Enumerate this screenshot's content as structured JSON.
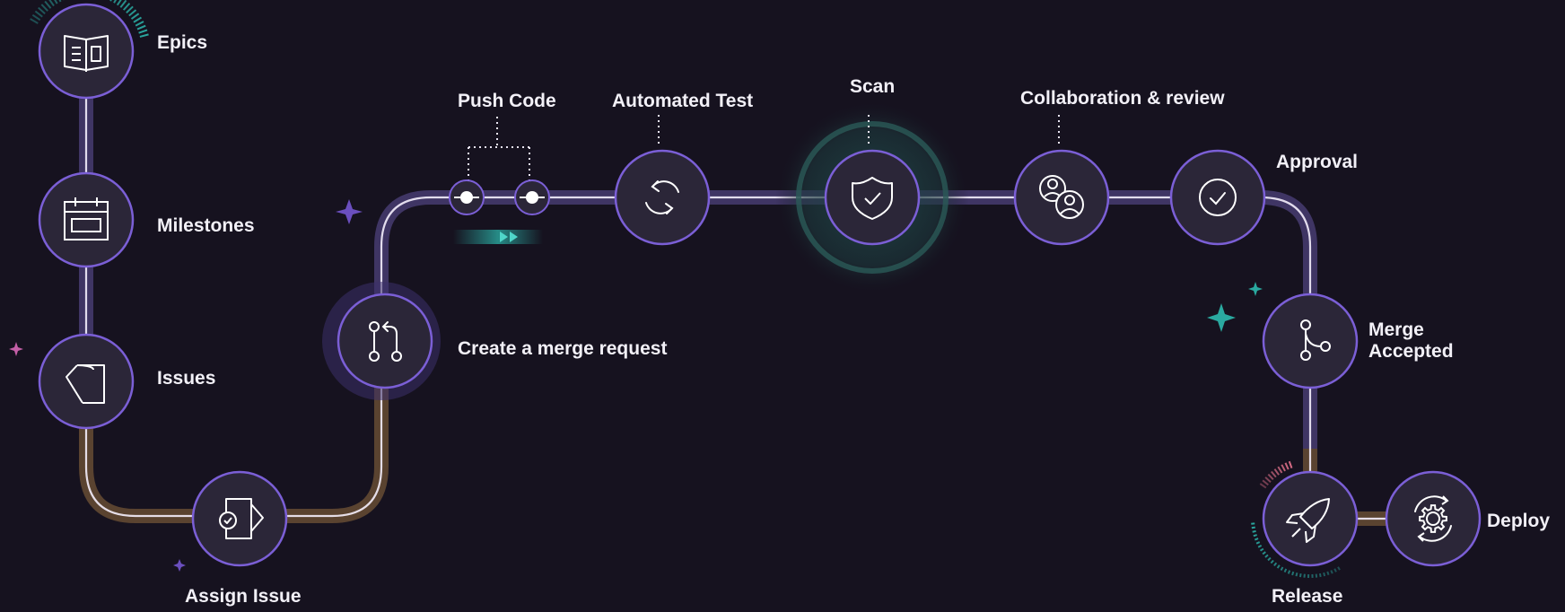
{
  "diagram": {
    "steps": [
      {
        "id": "epics",
        "label": "Epics",
        "icon": "book-icon"
      },
      {
        "id": "milestones",
        "label": "Milestones",
        "icon": "calendar-icon"
      },
      {
        "id": "issues",
        "label": "Issues",
        "icon": "issue-icon"
      },
      {
        "id": "assign",
        "label": "Assign Issue",
        "icon": "assign-issue-icon"
      },
      {
        "id": "merge_request",
        "label": "Create a merge request",
        "icon": "merge-request-icon"
      },
      {
        "id": "push",
        "label": "Push Code",
        "icon": "commit-icon"
      },
      {
        "id": "test",
        "label": "Automated Test",
        "icon": "refresh-icon"
      },
      {
        "id": "scan",
        "label": "Scan",
        "icon": "shield-check-icon"
      },
      {
        "id": "review",
        "label": "Collaboration & review",
        "icon": "users-icon"
      },
      {
        "id": "approval",
        "label": "Approval",
        "icon": "check-circle-icon"
      },
      {
        "id": "merge_accepted",
        "label": "Merge\nAccepted",
        "icon": "branch-icon"
      },
      {
        "id": "release",
        "label": "Release",
        "icon": "rocket-icon"
      },
      {
        "id": "deploy",
        "label": "Deploy",
        "icon": "deploy-gear-icon"
      }
    ]
  },
  "colors": {
    "background": "#16121f",
    "node_fill": "#2b2638",
    "node_stroke": "#7b5fd6",
    "track_purple": "#3f3564",
    "track_brown": "#5a4330",
    "teal": "#2aa9a0",
    "label": "#f2f0f7"
  }
}
